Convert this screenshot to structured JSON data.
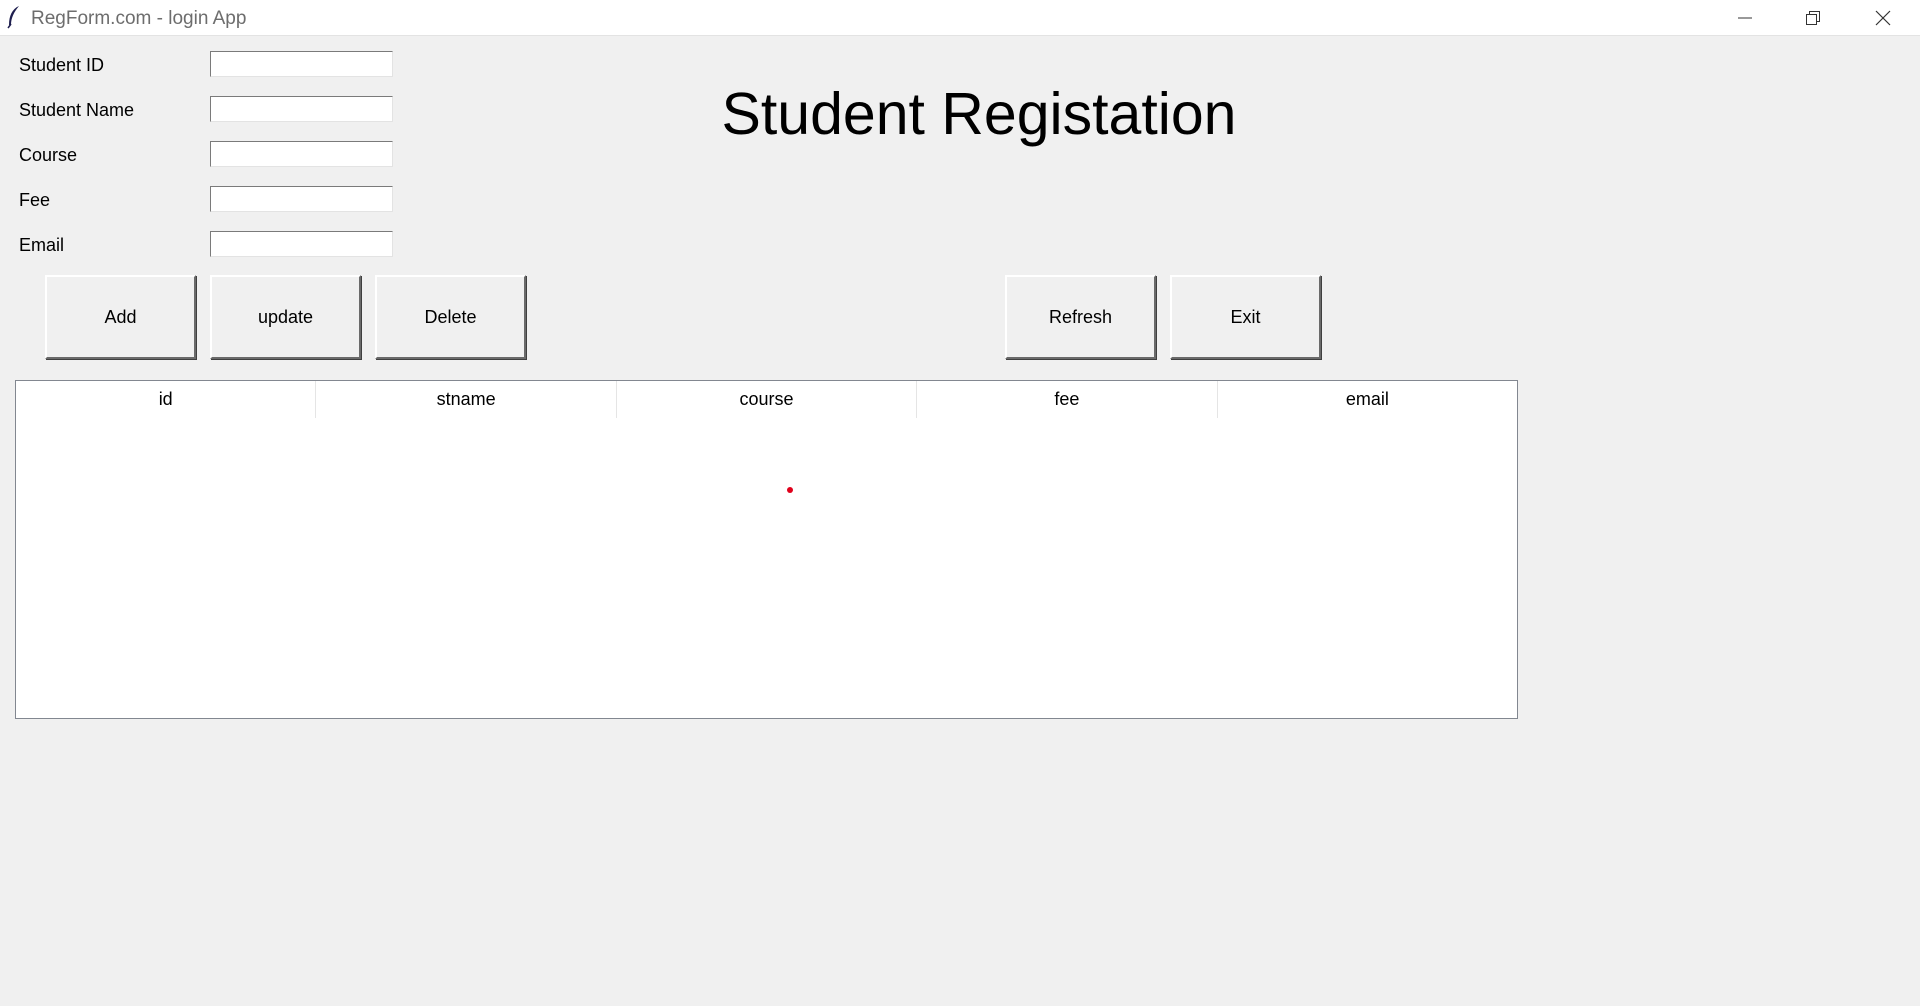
{
  "window": {
    "title": "RegForm.com - login App",
    "controls": [
      "minimize",
      "restore",
      "close"
    ]
  },
  "form": {
    "fields": [
      {
        "label": "Student ID",
        "value": ""
      },
      {
        "label": "Student Name",
        "value": ""
      },
      {
        "label": "Course",
        "value": ""
      },
      {
        "label": "Fee",
        "value": ""
      },
      {
        "label": "Email",
        "value": ""
      }
    ]
  },
  "heading": "Student Registation",
  "buttons": {
    "add": "Add",
    "update": "update",
    "delete": "Delete",
    "refresh": "Refresh",
    "exit": "Exit"
  },
  "table": {
    "columns": [
      "id",
      "stname",
      "course",
      "fee",
      "email"
    ],
    "rows": []
  },
  "colors": {
    "background": "#f0f0f0",
    "marker": "#e0001b"
  },
  "icons": {
    "app": "feather-icon",
    "minimize": "minimize-icon",
    "restore": "restore-icon",
    "close": "close-icon"
  }
}
